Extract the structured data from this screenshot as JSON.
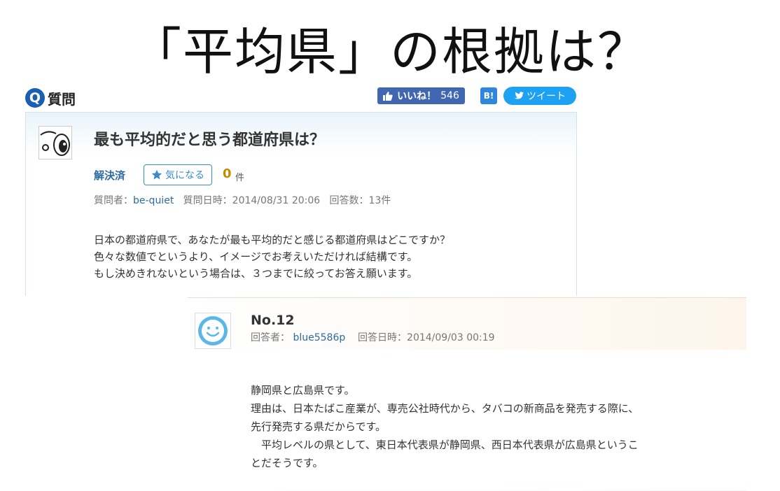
{
  "slide_title": "「平均県」の根拠は？",
  "question_header": {
    "icon": "Q",
    "label": "質問"
  },
  "social": {
    "like_label": "いいね！",
    "like_count": "546",
    "hatena_label": "B!",
    "tweet_label": "ツイート"
  },
  "question": {
    "title": "最も平均的だと思う都道府県は？",
    "status": "解決済",
    "favorite_label": "気になる",
    "favorite_count": "0",
    "favorite_unit": "件",
    "meta": {
      "asker_label": "質問者：",
      "asker": "be-quiet",
      "date_label": "質問日時：",
      "date": "2014/08/31 20:06",
      "answers_label": "回答数：",
      "answers": "13件"
    },
    "body": [
      "日本の都道府県で、あなたが最も平均的だと感じる都道府県はどこですか？",
      "色々な数値でというより、イメージでお考えいただければ結構です。",
      "もし決めきれないという場合は、３つまでに絞ってお答え願います。"
    ]
  },
  "answer": {
    "number": "No.12",
    "meta": {
      "answerer_label": "回答者：",
      "answerer": "blue5586p",
      "date_label": "回答日時：",
      "date": "2014/09/03 00:19"
    },
    "body": [
      "静岡県と広島県です。",
      "理由は、日本たばこ産業が、専売公社時代から、タバコの新商品を発売する際に、",
      "先行発売する県だからです。",
      "　平均レベルの県として、東日本代表県が静岡県、西日本代表県が広島県というこ",
      "とだそうです。"
    ]
  },
  "colors": {
    "brand_blue": "#1a5fb4",
    "facebook": "#4267b2",
    "twitter": "#1da1f2",
    "link": "#2c6aa0",
    "count_gold": "#c68a00",
    "avatar_face": "#5bb8e6"
  }
}
